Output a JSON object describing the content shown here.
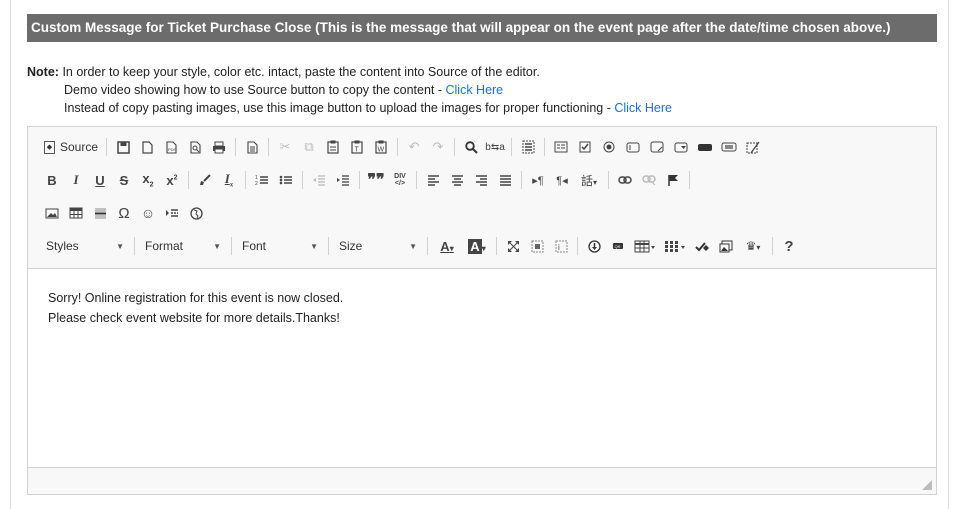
{
  "section": {
    "title": "Custom Message for Ticket Purchase Close (This is the message that will appear on the event page after the date/time chosen above.)"
  },
  "note": {
    "label": "Note:",
    "line1": "In order to keep your style, color etc. intact, paste the content into Source of the editor.",
    "line2_text": "Demo video showing how to use Source button to copy the content - ",
    "line2_link": "Click Here",
    "line3_text": "Instead of copy pasting images, use this image button to upload the images for proper functioning - ",
    "line3_link": "Click Here"
  },
  "toolbar": {
    "source_label": "Source",
    "styles_label": "Styles",
    "format_label": "Format",
    "font_label": "Font",
    "size_label": "Size",
    "help_label": "?"
  },
  "editor": {
    "content_line1": "Sorry! Online registration for this event is now closed.",
    "content_line2": "Please check event website for more details.Thanks!"
  },
  "colors": {
    "header_bg": "#6c6c6c",
    "link": "#1a6fd8",
    "toolbar_bg": "#f8f8f8"
  }
}
